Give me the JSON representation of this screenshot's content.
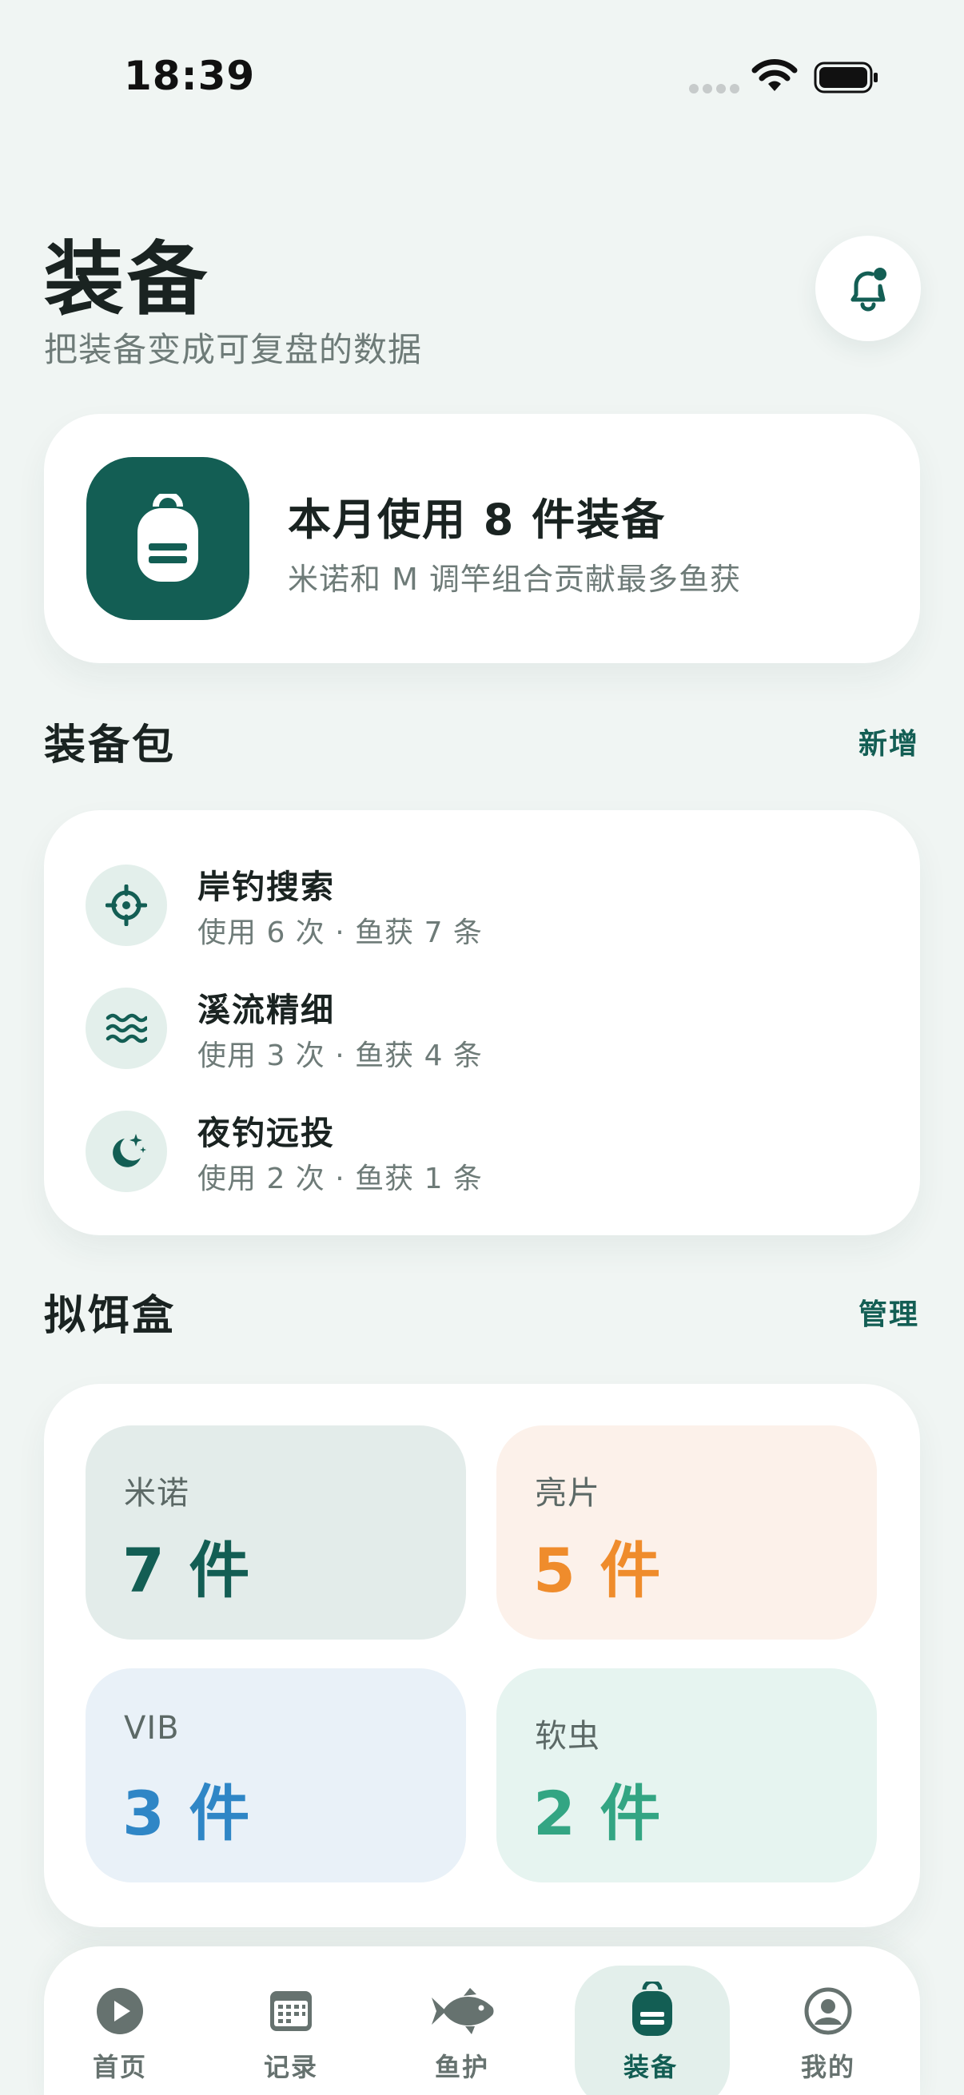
{
  "status_bar": {
    "time": "18:39",
    "icons": [
      "cellular-signal-icon",
      "wifi-icon",
      "battery-icon"
    ]
  },
  "header": {
    "title": "装备",
    "subtitle": "把装备变成可复盘的数据",
    "bell_icon": "bell-notification-icon"
  },
  "summary": {
    "icon": "backpack-icon",
    "title": "本月使用 8 件装备",
    "description": "米诺和 M 调竿组合贡献最多鱼获"
  },
  "kits": {
    "title": "装备包",
    "action": "新增",
    "items": [
      {
        "icon": "crosshair-icon",
        "name": "岸钓搜索",
        "meta": "使用 6 次 · 鱼获 7 条"
      },
      {
        "icon": "waves-icon",
        "name": "溪流精细",
        "meta": "使用 3 次 · 鱼获 4 条"
      },
      {
        "icon": "moon-stars-icon",
        "name": "夜钓远投",
        "meta": "使用 2 次 · 鱼获 1 条"
      }
    ]
  },
  "lures": {
    "title": "拟饵盒",
    "action": "管理",
    "items": [
      {
        "label": "米诺",
        "count": "7 件",
        "color": "#135e54",
        "bg": "#e3ecea"
      },
      {
        "label": "亮片",
        "count": "5 件",
        "color": "#ef8c2c",
        "bg": "#fcf1ea"
      },
      {
        "label": "VIB",
        "count": "3 件",
        "color": "#2f86c6",
        "bg": "#e9f1f8"
      },
      {
        "label": "软虫",
        "count": "2 件",
        "color": "#33a583",
        "bg": "#e6f4f0"
      }
    ]
  },
  "tabbar": {
    "active": "装备",
    "tabs": [
      {
        "label": "首页",
        "icon": "play-circle-icon"
      },
      {
        "label": "记录",
        "icon": "calendar-icon"
      },
      {
        "label": "鱼护",
        "icon": "fish-icon"
      },
      {
        "label": "装备",
        "icon": "backpack-icon"
      },
      {
        "label": "我的",
        "icon": "profile-icon"
      }
    ]
  }
}
